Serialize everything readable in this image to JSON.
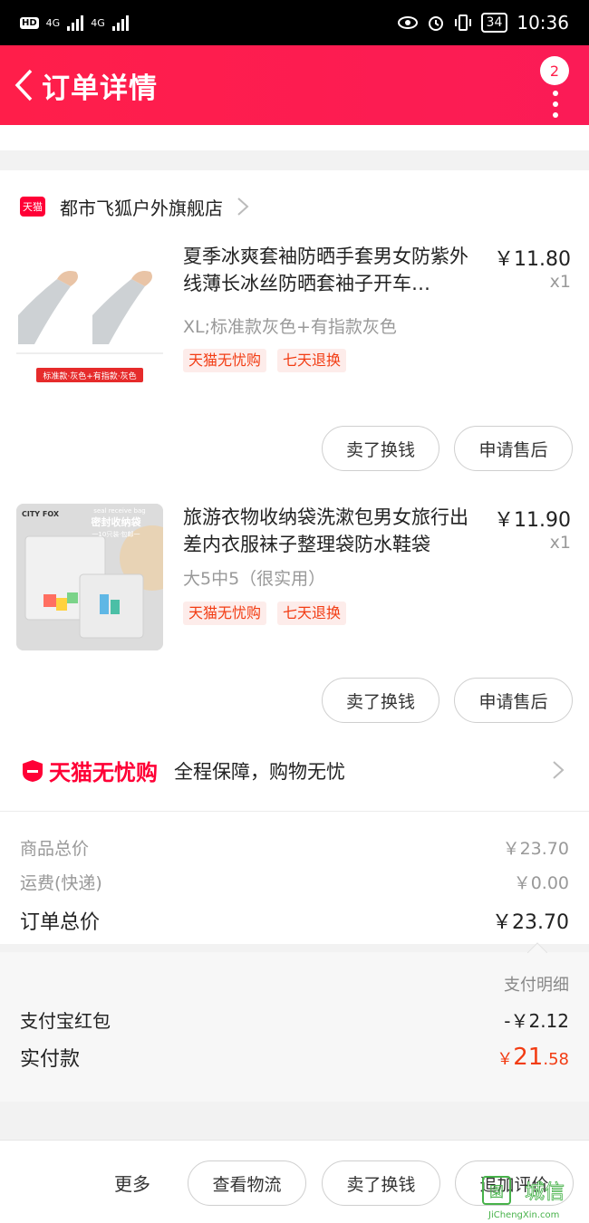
{
  "status_bar": {
    "hd": "HD",
    "net1": "4G",
    "net2": "4G",
    "battery": "34",
    "time": "10:36"
  },
  "navbar": {
    "title": "订单详情",
    "badge_count": "2"
  },
  "store": {
    "badge": "天猫",
    "name": "都市飞狐户外旗舰店"
  },
  "products": [
    {
      "title": "夏季冰爽套袖防晒手套男女防紫外线薄长冰丝防晒套袖子开车…",
      "price": "￥11.80",
      "qty": "x1",
      "sku": "XL;标准款灰色+有指款灰色",
      "image_caption": "标准款·灰色+有指款·灰色",
      "tags": [
        "天猫无忧购",
        "七天退换"
      ],
      "actions": [
        "卖了换钱",
        "申请售后"
      ]
    },
    {
      "title": "旅游衣物收纳袋洗漱包男女旅行出差内衣服袜子整理袋防水鞋袋",
      "price": "￥11.90",
      "qty": "x1",
      "sku": "大5中5（很实用）",
      "image_brand": "CITY FOX",
      "image_label_en": "seal receive bag",
      "image_label": "密封收纳袋",
      "image_sub": "一10只装·包邮一",
      "tags": [
        "天猫无忧购",
        "七天退换"
      ],
      "actions": [
        "卖了换钱",
        "申请售后"
      ]
    }
  ],
  "assurance": {
    "logo": "天猫无忧购",
    "text": "全程保障，购物无忧"
  },
  "summary": {
    "goods_label": "商品总价",
    "goods_value": "￥23.70",
    "shipping_label": "运费(快递)",
    "shipping_value": "￥0.00",
    "total_label": "订单总价",
    "total_value": "￥23.70"
  },
  "payment": {
    "detail_label": "支付明细",
    "redpacket_label": "支付宝红包",
    "redpacket_value": "-￥2.12",
    "actual_label": "实付款",
    "actual_currency": "￥",
    "actual_int": "21",
    "actual_dec": ".58"
  },
  "bottom_bar": {
    "more": "更多",
    "buttons": [
      "查看物流",
      "卖了换钱",
      "追加评价"
    ]
  },
  "watermark": {
    "text": "JiChengXin.com",
    "brand": "城信"
  },
  "colors": {
    "brand_red": "#ff1e4a",
    "tag_text": "#f23c13",
    "tag_bg": "#fdecea"
  }
}
